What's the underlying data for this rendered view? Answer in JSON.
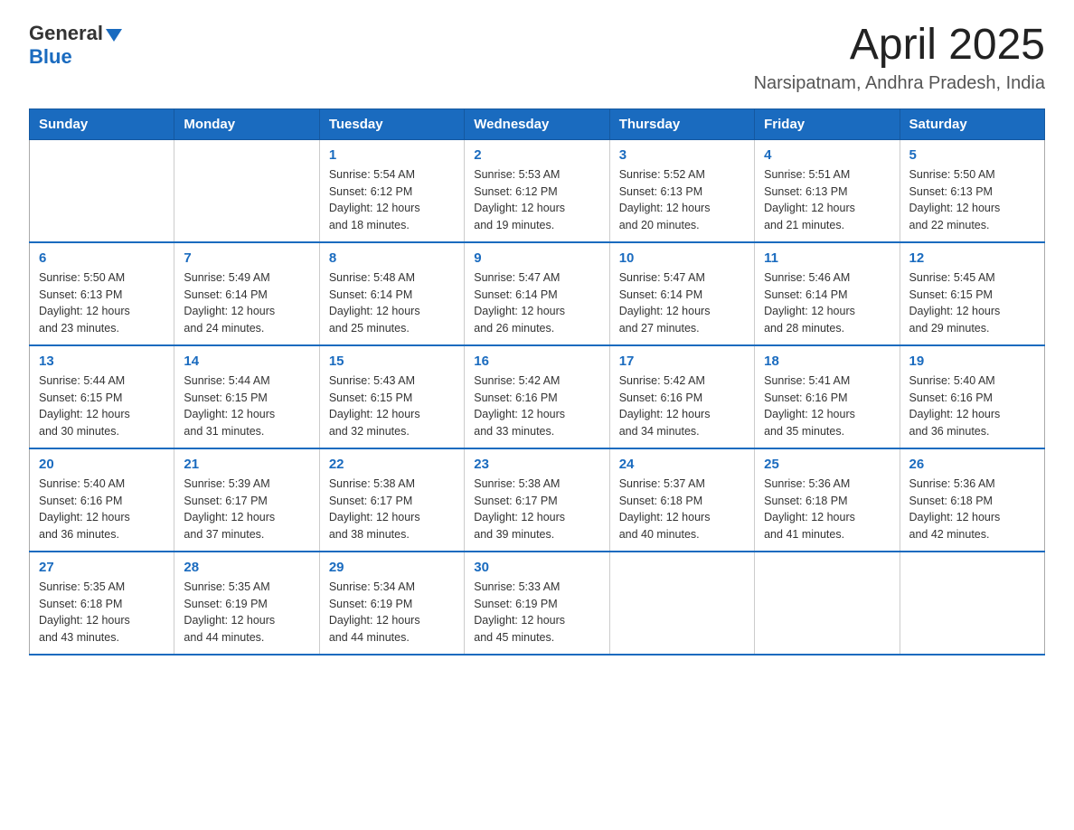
{
  "header": {
    "logo_general": "General",
    "logo_blue": "Blue",
    "month_title": "April 2025",
    "location": "Narsipatnam, Andhra Pradesh, India"
  },
  "weekdays": [
    "Sunday",
    "Monday",
    "Tuesday",
    "Wednesday",
    "Thursday",
    "Friday",
    "Saturday"
  ],
  "weeks": [
    [
      {
        "day": "",
        "info": ""
      },
      {
        "day": "",
        "info": ""
      },
      {
        "day": "1",
        "info": "Sunrise: 5:54 AM\nSunset: 6:12 PM\nDaylight: 12 hours\nand 18 minutes."
      },
      {
        "day": "2",
        "info": "Sunrise: 5:53 AM\nSunset: 6:12 PM\nDaylight: 12 hours\nand 19 minutes."
      },
      {
        "day": "3",
        "info": "Sunrise: 5:52 AM\nSunset: 6:13 PM\nDaylight: 12 hours\nand 20 minutes."
      },
      {
        "day": "4",
        "info": "Sunrise: 5:51 AM\nSunset: 6:13 PM\nDaylight: 12 hours\nand 21 minutes."
      },
      {
        "day": "5",
        "info": "Sunrise: 5:50 AM\nSunset: 6:13 PM\nDaylight: 12 hours\nand 22 minutes."
      }
    ],
    [
      {
        "day": "6",
        "info": "Sunrise: 5:50 AM\nSunset: 6:13 PM\nDaylight: 12 hours\nand 23 minutes."
      },
      {
        "day": "7",
        "info": "Sunrise: 5:49 AM\nSunset: 6:14 PM\nDaylight: 12 hours\nand 24 minutes."
      },
      {
        "day": "8",
        "info": "Sunrise: 5:48 AM\nSunset: 6:14 PM\nDaylight: 12 hours\nand 25 minutes."
      },
      {
        "day": "9",
        "info": "Sunrise: 5:47 AM\nSunset: 6:14 PM\nDaylight: 12 hours\nand 26 minutes."
      },
      {
        "day": "10",
        "info": "Sunrise: 5:47 AM\nSunset: 6:14 PM\nDaylight: 12 hours\nand 27 minutes."
      },
      {
        "day": "11",
        "info": "Sunrise: 5:46 AM\nSunset: 6:14 PM\nDaylight: 12 hours\nand 28 minutes."
      },
      {
        "day": "12",
        "info": "Sunrise: 5:45 AM\nSunset: 6:15 PM\nDaylight: 12 hours\nand 29 minutes."
      }
    ],
    [
      {
        "day": "13",
        "info": "Sunrise: 5:44 AM\nSunset: 6:15 PM\nDaylight: 12 hours\nand 30 minutes."
      },
      {
        "day": "14",
        "info": "Sunrise: 5:44 AM\nSunset: 6:15 PM\nDaylight: 12 hours\nand 31 minutes."
      },
      {
        "day": "15",
        "info": "Sunrise: 5:43 AM\nSunset: 6:15 PM\nDaylight: 12 hours\nand 32 minutes."
      },
      {
        "day": "16",
        "info": "Sunrise: 5:42 AM\nSunset: 6:16 PM\nDaylight: 12 hours\nand 33 minutes."
      },
      {
        "day": "17",
        "info": "Sunrise: 5:42 AM\nSunset: 6:16 PM\nDaylight: 12 hours\nand 34 minutes."
      },
      {
        "day": "18",
        "info": "Sunrise: 5:41 AM\nSunset: 6:16 PM\nDaylight: 12 hours\nand 35 minutes."
      },
      {
        "day": "19",
        "info": "Sunrise: 5:40 AM\nSunset: 6:16 PM\nDaylight: 12 hours\nand 36 minutes."
      }
    ],
    [
      {
        "day": "20",
        "info": "Sunrise: 5:40 AM\nSunset: 6:16 PM\nDaylight: 12 hours\nand 36 minutes."
      },
      {
        "day": "21",
        "info": "Sunrise: 5:39 AM\nSunset: 6:17 PM\nDaylight: 12 hours\nand 37 minutes."
      },
      {
        "day": "22",
        "info": "Sunrise: 5:38 AM\nSunset: 6:17 PM\nDaylight: 12 hours\nand 38 minutes."
      },
      {
        "day": "23",
        "info": "Sunrise: 5:38 AM\nSunset: 6:17 PM\nDaylight: 12 hours\nand 39 minutes."
      },
      {
        "day": "24",
        "info": "Sunrise: 5:37 AM\nSunset: 6:18 PM\nDaylight: 12 hours\nand 40 minutes."
      },
      {
        "day": "25",
        "info": "Sunrise: 5:36 AM\nSunset: 6:18 PM\nDaylight: 12 hours\nand 41 minutes."
      },
      {
        "day": "26",
        "info": "Sunrise: 5:36 AM\nSunset: 6:18 PM\nDaylight: 12 hours\nand 42 minutes."
      }
    ],
    [
      {
        "day": "27",
        "info": "Sunrise: 5:35 AM\nSunset: 6:18 PM\nDaylight: 12 hours\nand 43 minutes."
      },
      {
        "day": "28",
        "info": "Sunrise: 5:35 AM\nSunset: 6:19 PM\nDaylight: 12 hours\nand 44 minutes."
      },
      {
        "day": "29",
        "info": "Sunrise: 5:34 AM\nSunset: 6:19 PM\nDaylight: 12 hours\nand 44 minutes."
      },
      {
        "day": "30",
        "info": "Sunrise: 5:33 AM\nSunset: 6:19 PM\nDaylight: 12 hours\nand 45 minutes."
      },
      {
        "day": "",
        "info": ""
      },
      {
        "day": "",
        "info": ""
      },
      {
        "day": "",
        "info": ""
      }
    ]
  ]
}
